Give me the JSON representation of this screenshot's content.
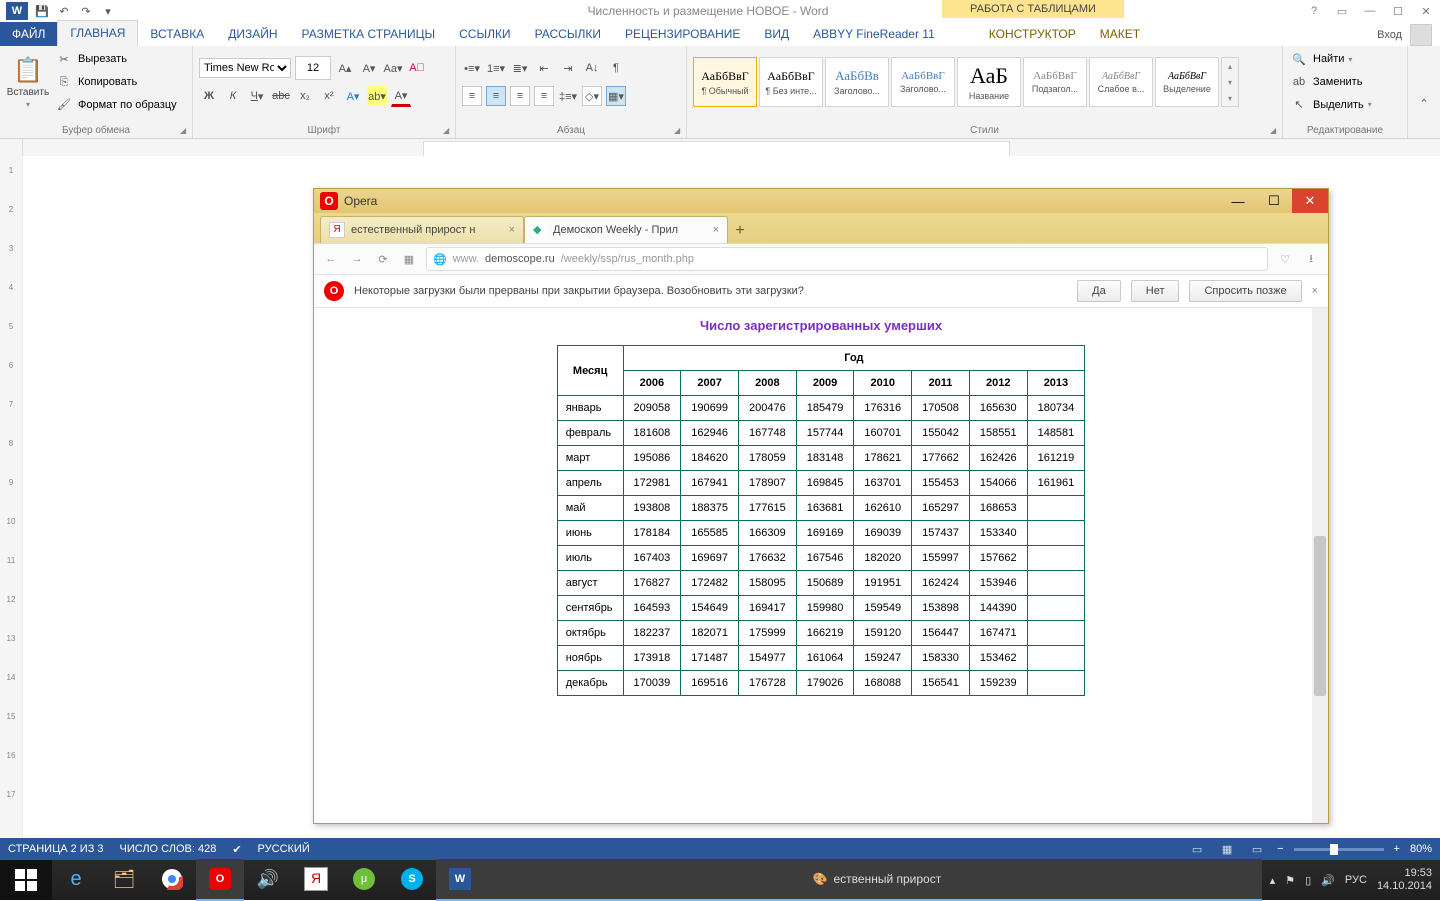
{
  "word": {
    "title": "Численность и размещение НОВОЕ - Word",
    "table_tools": "РАБОТА С ТАБЛИЦАМИ",
    "signin": "Вход",
    "tabs": {
      "file": "ФАЙЛ",
      "home": "ГЛАВНАЯ",
      "insert": "ВСТАВКА",
      "design": "ДИЗАЙН",
      "layout": "РАЗМЕТКА СТРАНИЦЫ",
      "refs": "ССЫЛКИ",
      "mail": "РАССЫЛКИ",
      "review": "РЕЦЕНЗИРОВАНИЕ",
      "view": "ВИД",
      "abbyy": "ABBYY FineReader 11",
      "constr": "КОНСТРУКТОР",
      "layout2": "МАКЕТ"
    },
    "groups": {
      "clipboard": "Буфер обмена",
      "font": "Шрифт",
      "para": "Абзац",
      "styles": "Стили",
      "editing": "Редактирование"
    },
    "clipboard": {
      "paste": "Вставить",
      "cut": "Вырезать",
      "copy": "Копировать",
      "painter": "Формат по образцу"
    },
    "font": {
      "name": "Times New Roman",
      "size": "12"
    },
    "styles": [
      {
        "sample": "АаБбВвГ",
        "name": "¶ Обычный"
      },
      {
        "sample": "АаБбВвГ",
        "name": "¶ Без инте..."
      },
      {
        "sample": "АаБбВв",
        "name": "Заголово..."
      },
      {
        "sample": "АаБбВвГ",
        "name": "Заголово..."
      },
      {
        "sample": "АаБ",
        "name": "Название"
      },
      {
        "sample": "АаБбВвГ",
        "name": "Подзагол..."
      },
      {
        "sample": "АаБбВвГ",
        "name": "Слабое в..."
      },
      {
        "sample": "АаБбВвГ",
        "name": "Выделение"
      }
    ],
    "editing": {
      "find": "Найти",
      "replace": "Заменить",
      "select": "Выделить"
    },
    "status": {
      "page": "СТРАНИЦА 2 ИЗ 3",
      "words": "ЧИСЛО СЛОВ: 428",
      "lang": "РУССКИЙ",
      "zoom": "80%"
    }
  },
  "opera": {
    "appname": "Opera",
    "tab1": "естественный прирост н",
    "tab2": "Демоскоп Weekly - Прил",
    "url_host": "demoscope.ru",
    "url_rest": "/weekly/ssp/rus_month.php",
    "url_prefix": "www.",
    "infobar_msg": "Некоторые загрузки были прерваны при закрытии браузера. Возобновить эти загрузки?",
    "btn_yes": "Да",
    "btn_no": "Нет",
    "btn_later": "Спросить позже",
    "table_title": "Число зарегистрированных умерших",
    "col_month": "Месяц",
    "col_year": "Год",
    "years": [
      "2006",
      "2007",
      "2008",
      "2009",
      "2010",
      "2011",
      "2012",
      "2013"
    ],
    "rows": [
      {
        "m": "январь",
        "v": [
          "209058",
          "190699",
          "200476",
          "185479",
          "176316",
          "170508",
          "165630",
          "180734"
        ]
      },
      {
        "m": "февраль",
        "v": [
          "181608",
          "162946",
          "167748",
          "157744",
          "160701",
          "155042",
          "158551",
          "148581"
        ]
      },
      {
        "m": "март",
        "v": [
          "195086",
          "184620",
          "178059",
          "183148",
          "178621",
          "177662",
          "162426",
          "161219"
        ]
      },
      {
        "m": "апрель",
        "v": [
          "172981",
          "167941",
          "178907",
          "169845",
          "163701",
          "155453",
          "154066",
          "161961"
        ]
      },
      {
        "m": "май",
        "v": [
          "193808",
          "188375",
          "177615",
          "163681",
          "162610",
          "165297",
          "168653",
          ""
        ]
      },
      {
        "m": "июнь",
        "v": [
          "178184",
          "165585",
          "166309",
          "169169",
          "169039",
          "157437",
          "153340",
          ""
        ]
      },
      {
        "m": "июль",
        "v": [
          "167403",
          "169697",
          "176632",
          "167546",
          "182020",
          "155997",
          "157662",
          ""
        ]
      },
      {
        "m": "август",
        "v": [
          "176827",
          "172482",
          "158095",
          "150689",
          "191951",
          "162424",
          "153946",
          ""
        ]
      },
      {
        "m": "сентябрь",
        "v": [
          "164593",
          "154649",
          "169417",
          "159980",
          "159549",
          "153898",
          "144390",
          ""
        ]
      },
      {
        "m": "октябрь",
        "v": [
          "182237",
          "182071",
          "175999",
          "166219",
          "159120",
          "156447",
          "167471",
          ""
        ]
      },
      {
        "m": "ноябрь",
        "v": [
          "173918",
          "171487",
          "154977",
          "161064",
          "159247",
          "158330",
          "153462",
          ""
        ]
      },
      {
        "m": "декабрь",
        "v": [
          "170039",
          "169516",
          "176728",
          "179026",
          "168088",
          "156541",
          "159239",
          ""
        ]
      }
    ]
  },
  "taskbar": {
    "active_title": "ественный прирост",
    "lang": "РУС",
    "time": "19:53",
    "date": "14.10.2014"
  }
}
